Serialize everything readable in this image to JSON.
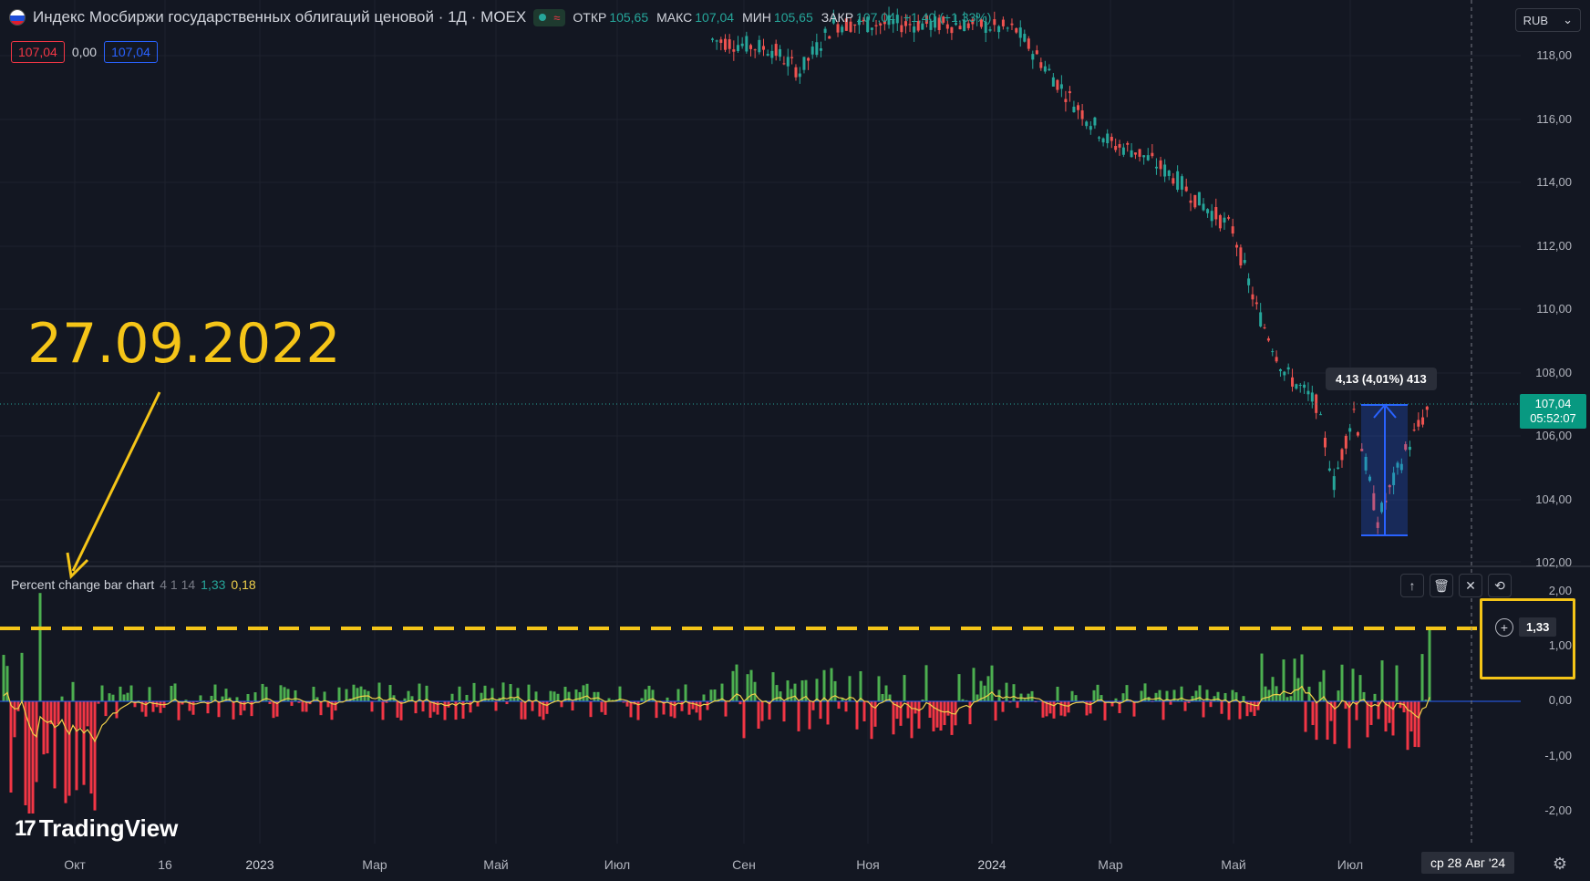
{
  "header": {
    "title": "Индекс Мосбиржи государственных облигаций ценовой · 1Д · MOEX",
    "ohlc": [
      {
        "label": "ОТКР",
        "value": "105,65"
      },
      {
        "label": "МАКС",
        "value": "107,04"
      },
      {
        "label": "МИН",
        "value": "105,65"
      },
      {
        "label": "ЗАКР",
        "value": "107,04"
      }
    ],
    "change": "+1,40 (+1,33%)",
    "boxes": {
      "left": "107,04",
      "mid": "0,00",
      "right": "107,04"
    },
    "currency": "RUB",
    "currency_chevron": "chevron-down-icon"
  },
  "price_axis": {
    "labels": [
      "118,00",
      "116,00",
      "114,00",
      "112,00",
      "110,00",
      "108,00",
      "106,00",
      "104,00",
      "102,00"
    ],
    "last_price": "107,04",
    "countdown": "05:52:07"
  },
  "measure": {
    "label": "4,13 (4,01%) 413"
  },
  "indicator": {
    "title": "Percent change bar chart",
    "params": "4 1 14",
    "value1": "1,33",
    "value2": "0,18",
    "axis_labels": [
      "2,00",
      "1,00",
      "0,00",
      "-1,00",
      "-2,00"
    ],
    "highlight_value": "1,33",
    "buttons": [
      "arrow-up-icon",
      "trash-icon",
      "collapse-icon",
      "swap-icon"
    ]
  },
  "time_axis": {
    "labels": [
      "Окт",
      "16",
      "2023",
      "Мар",
      "Май",
      "Июл",
      "Сен",
      "Ноя",
      "2024",
      "Мар",
      "Май",
      "Июл"
    ],
    "cursor_date": "ср 28 Авг '24"
  },
  "annotation": {
    "text": "27.09.2022"
  },
  "branding": {
    "logo_text": "TradingView"
  },
  "colors": {
    "background": "#131722",
    "up": "#4caf50",
    "down": "#f23645",
    "candle_up": "#26a69a",
    "candle_down": "#ef5350",
    "accent": "#f5c518",
    "measure": "#2962ff"
  },
  "chart_data": [
    {
      "type": "line",
      "title": "Индекс Мосбиржи государственных облигаций ценовой",
      "ylabel": "",
      "ylim": [
        102,
        119
      ],
      "x": [
        "2023-09-01",
        "2023-10-01",
        "2023-10-15",
        "2023-11-01",
        "2023-12-01",
        "2024-01-10",
        "2024-02-01",
        "2024-03-01",
        "2024-03-20",
        "2024-04-01",
        "2024-04-20",
        "2024-05-01",
        "2024-05-20",
        "2024-06-01",
        "2024-06-15",
        "2024-07-01",
        "2024-07-10",
        "2024-07-20",
        "2024-08-01",
        "2024-08-15",
        "2024-08-28"
      ],
      "values": [
        118.5,
        118.2,
        117.5,
        119.0,
        119.0,
        119.0,
        118.8,
        116.5,
        115.2,
        115.0,
        114.2,
        113.5,
        112.5,
        110.0,
        108.0,
        107.0,
        104.5,
        106.8,
        103.3,
        105.5,
        107.04
      ]
    },
    {
      "type": "bar",
      "title": "Percent change bar chart",
      "ylim": [
        -2.2,
        2.2
      ],
      "x_range": [
        "2022-09-21",
        "2024-08-28"
      ],
      "notable": [
        {
          "date": "2022-09-27",
          "value": 1.98
        },
        {
          "date": "2022-09-23",
          "value": -2.05
        },
        {
          "date": "2024-08-28",
          "value": 1.33
        }
      ],
      "reference_line": 1.33
    }
  ]
}
